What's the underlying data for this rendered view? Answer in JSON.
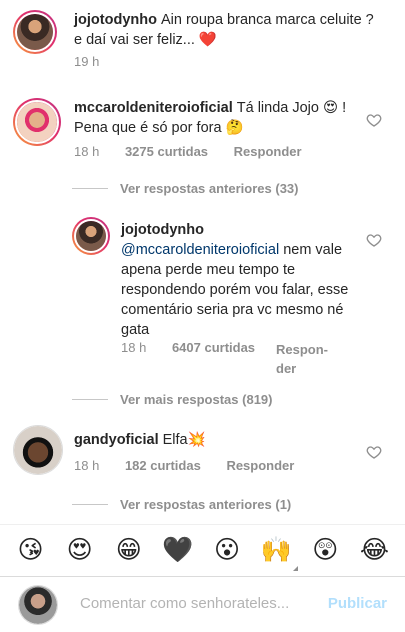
{
  "comments": [
    {
      "user": "jojotodynho",
      "text": "Ain roupa branca marca celuite ? e daí vai ser feliz... ❤️",
      "time": "19 h"
    },
    {
      "user": "mccaroldeniteroioficial",
      "text": "Tá linda Jojo 😍 ! Pena que é só por fora 🤔",
      "time": "18 h",
      "likes": "3275 curtidas",
      "reply": "Responder",
      "thread_link": "Ver respostas anteriores (33)"
    },
    {
      "user": "jojotodynho",
      "mention": "@mccaroldeniteroioficial",
      "text": " nem vale apena perde meu tempo  te respondendo porém  vou falar, esse comentário  seria pra vc mesmo né  gata",
      "time": "18 h",
      "likes": "6407 curtidas",
      "reply_line1": "Respon-",
      "reply_line2": "der",
      "more_link": "Ver mais respostas (819)"
    },
    {
      "user": "gandyoficial",
      "text": "Elfa💥",
      "time": "18 h",
      "likes": "182 curtidas",
      "reply": "Responder",
      "thread_link": "Ver respostas anteriores (1)"
    }
  ],
  "emoji_bar": [
    "😘",
    "😍",
    "😁",
    "🖤",
    "😮",
    "🙌",
    "😲",
    "😂"
  ],
  "compose": {
    "placeholder": "Comentar como senhorateles...",
    "publish": "Publicar"
  },
  "colors": {
    "link": "#00376b",
    "muted": "#8e8e8e",
    "publish_disabled": "#b2dffc"
  }
}
